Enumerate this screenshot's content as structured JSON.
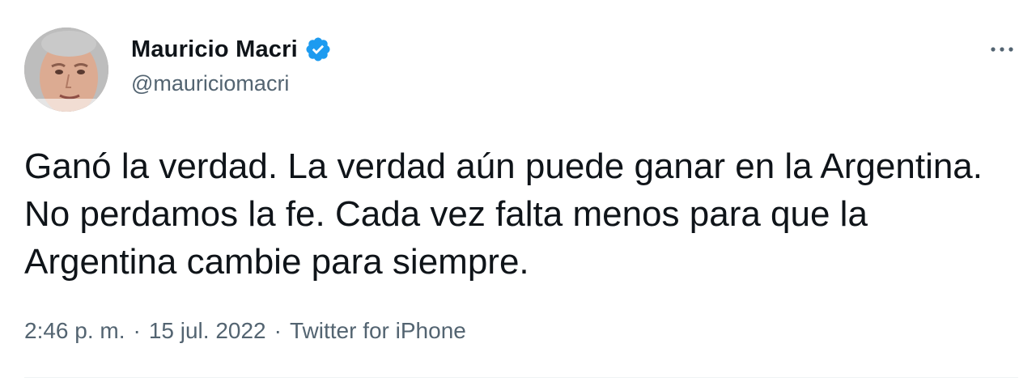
{
  "author": {
    "display_name": "Mauricio Macri",
    "handle": "@mauriciomacri",
    "verified_icon": "verified-badge-icon"
  },
  "tweet": {
    "text": "Ganó la verdad. La verdad aún puede ganar en la Argentina. No perdamos la fe. Cada vez falta menos para que la Argentina cambie para siempre."
  },
  "meta": {
    "time": "2:46 p. m.",
    "separator": "·",
    "date": "15 jul. 2022",
    "source": "Twitter for iPhone"
  },
  "actions": {
    "more_icon": "more-horizontal-icon"
  },
  "colors": {
    "text": "#0f1419",
    "secondary": "#536471",
    "verified": "#1d9bf0",
    "divider": "#eff3f4"
  }
}
